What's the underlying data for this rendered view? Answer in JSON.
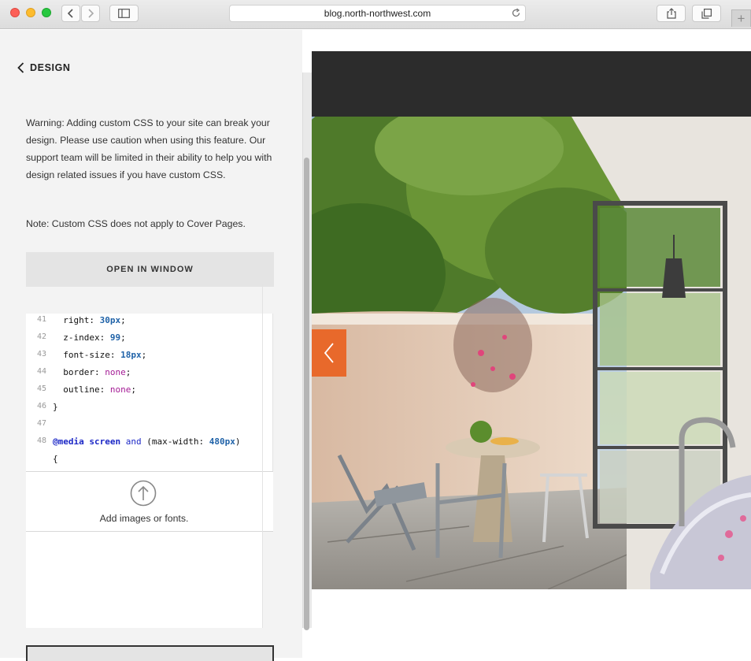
{
  "browser": {
    "url": "blog.north-northwest.com"
  },
  "panel": {
    "back_label": "DESIGN",
    "warning": "Warning: Adding custom CSS to your site can break your design. Please use caution when using this feature. Our support team will be limited in their ability to help you with design related issues if you have custom CSS.",
    "note": "Note: Custom CSS does not apply to Cover Pages.",
    "open_button": "OPEN IN WINDOW",
    "upload_label": "Add images or fonts."
  },
  "editor": {
    "lines": [
      {
        "n": "41",
        "text": "  right: 30px;"
      },
      {
        "n": "42",
        "text": "  z-index: 99;"
      },
      {
        "n": "43",
        "text": "  font-size: 18px;"
      },
      {
        "n": "44",
        "text": "  border: none;"
      },
      {
        "n": "45",
        "text": "  outline: none;"
      },
      {
        "n": "46",
        "text": "}"
      },
      {
        "n": "47",
        "text": ""
      },
      {
        "n": "48",
        "text": "@media screen and (max-width: 480px)"
      },
      {
        "n": "",
        "text": "{"
      }
    ]
  },
  "colors": {
    "accent": "#e8692b",
    "header_band": "#2c2c2c"
  }
}
